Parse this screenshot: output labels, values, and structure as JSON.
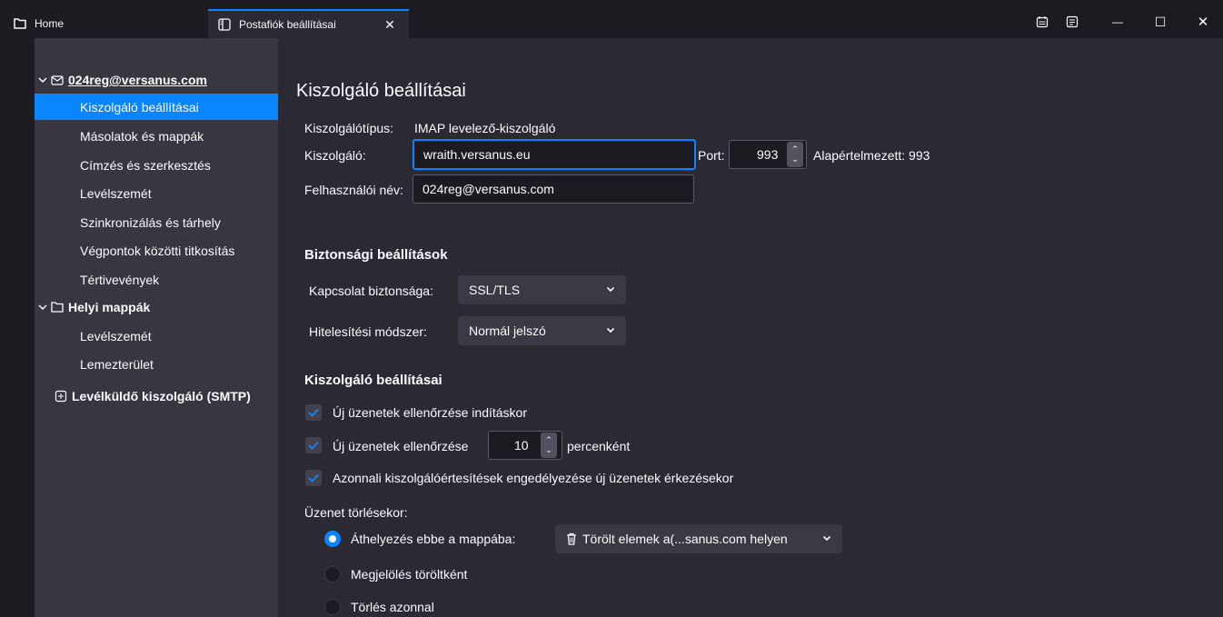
{
  "tabs": {
    "home_label": "Home",
    "settings_label": "Postafiók beállításai",
    "close_glyph": "✕"
  },
  "window": {
    "minimize_glyph": "—",
    "maximize_glyph": "☐",
    "close_glyph": "✕"
  },
  "sidebar": {
    "account": "024reg@versanus.com",
    "account_items": [
      "Kiszolgáló beállításai",
      "Másolatok és mappák",
      "Címzés és szerkesztés",
      "Levélszemét",
      "Szinkronizálás és tárhely",
      "Végpontok közötti titkosítás",
      "Tértivevények"
    ],
    "local_folders": "Helyi mappák",
    "local_items": [
      "Levélszemét",
      "Lemezterület"
    ],
    "smtp": "Levélküldő kiszolgáló (SMTP)"
  },
  "main": {
    "title": "Kiszolgáló beállításai",
    "server_type_label": "Kiszolgálótípus:",
    "server_type_value": "IMAP levelező-kiszolgáló",
    "server_label": "Kiszolgáló:",
    "server_value": "wraith.versanus.eu",
    "port_label": "Port:",
    "port_value": "993",
    "default_port": "Alapértelmezett: 993",
    "username_label": "Felhasználói név:",
    "username_value": "024reg@versanus.com",
    "security_heading": "Biztonsági beállítások",
    "conn_security_label": "Kapcsolat biztonsága:",
    "conn_security_value": "SSL/TLS",
    "auth_label": "Hitelesítési módszer:",
    "auth_value": "Normál jelszó",
    "server_settings_heading": "Kiszolgáló beállításai",
    "check_startup": "Új üzenetek ellenőrzése indításkor",
    "check_every": "Új üzenetek ellenőrzése",
    "check_interval": "10",
    "minutes_suffix": "percenként",
    "push_notify": "Azonnali kiszolgálóértesítések engedélyezése új üzenetek érkezésekor",
    "on_delete_label": "Üzenet törlésekor:",
    "move_to_folder": "Áthelyezés ebbe a mappába:",
    "trash_folder": "Törölt elemek a(...sanus.com helyen",
    "mark_deleted": "Megjelölés töröltként",
    "delete_now": "Törlés azonnal"
  },
  "colors": {
    "accent": "#0a84ff",
    "sidebar_bg": "#38373f",
    "main_bg": "#2b2a33",
    "frame_bg": "#1c1b22"
  }
}
